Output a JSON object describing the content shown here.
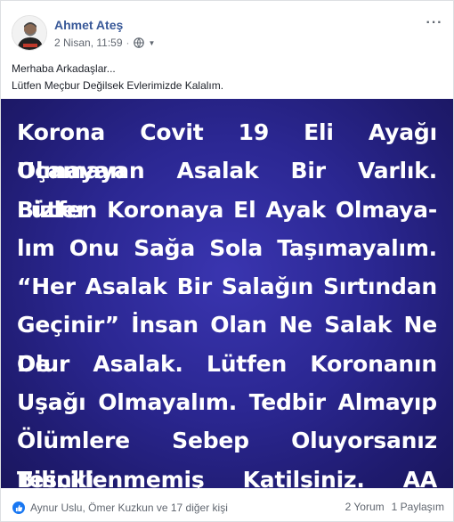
{
  "post": {
    "author": "Ahmet Ateş",
    "date": "2 Nisan, 11:59",
    "separator": "·",
    "more_icon": "more-dots-icon",
    "text_lines": [
      "Merhaba Arkadaşlar...",
      "Lütfen Meçbur Değilsek Evlerimizde Kalalım."
    ]
  },
  "image": {
    "background_color": "#2b2792",
    "lines": [
      "Korona Covit 19 Eli Ayağı Olmayan",
      "Uçamayan Asalak Bir Varlık. Bizler",
      "Lütfen Koronaya El Ayak Olmaya-",
      "lım Onu Sağa Sola Taşımayalım.",
      "“Her Asalak Bir Salağın Sırtından",
      "Geçinir” İnsan Olan Ne Salak Ne De",
      "Olur Asalak. Lütfen Koronanın",
      "Uşağı Olmayalım.  Tedbir Almayıp",
      "Ölümlere Sebep Oluyorsanız Bilinki",
      "Tescillenmemiş Katilsiniz. AA"
    ]
  },
  "footer": {
    "reactions": "Aynur Uslu, Ömer Kuzkun ve 17 diğer kişi",
    "comments": "2 Yorum",
    "shares": "1 Paylaşım",
    "like_color": "#1877f2"
  }
}
